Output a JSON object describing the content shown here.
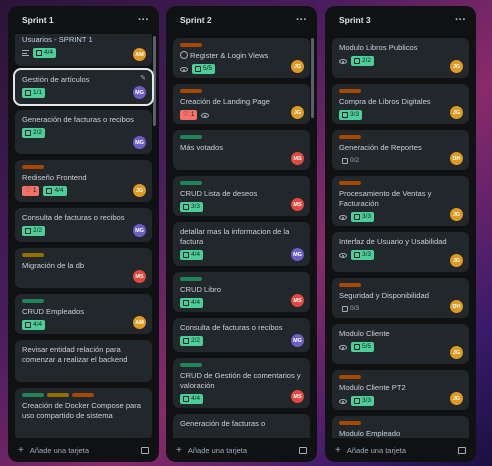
{
  "colors": {
    "orange": "#c25100",
    "orange_lbl": "#a54800",
    "green_lbl": "#1f845a",
    "yellow_lbl": "#946f00",
    "red_lbl": "#c9372c",
    "avatar_am": "#e09a22",
    "avatar_mg": "#6e5dc6",
    "avatar_jg": "#e0a000",
    "avatar_ms": "#e2483d",
    "avatar_dh": "#e0a000"
  },
  "footer": {
    "add_label": "Añade una tarjeta"
  },
  "lists": [
    {
      "title": "Sprint 1",
      "cards": [
        {
          "title": "Usuarios - SPRINT 1",
          "check": "4/4",
          "avatar": "AM"
        },
        {
          "title": "Gestión de artículos",
          "check": "1/1",
          "avatar": "MG"
        },
        {
          "title": "Generación de facturas o recibos",
          "check": "2/2",
          "avatar": "MG"
        },
        {
          "title": "Rediseño Frontend",
          "count": "1",
          "check": "4/4",
          "avatar": "JG"
        },
        {
          "title": "Consulta de facturas o recibos",
          "check": "2/2",
          "avatar": "MG"
        },
        {
          "title": "Migración de la db",
          "avatar": "MS"
        },
        {
          "title": "CRUD Empleados",
          "check": "4/4",
          "avatar": "AM"
        },
        {
          "title": "Revisar entidad relación para comenzar a realizar el backend"
        },
        {
          "title": "Creación de Docker Compose para uso compartido de sistema"
        }
      ]
    },
    {
      "title": "Sprint 2",
      "cards": [
        {
          "title": "Register & Login Views",
          "check": "5/5",
          "avatar": "JG"
        },
        {
          "title": "Creación de Landing Page",
          "count": "1",
          "avatar": "JG"
        },
        {
          "title": "Más votados",
          "avatar": "MS"
        },
        {
          "title": "CRUD Lista de deseos",
          "check": "3/3",
          "avatar": "MS"
        },
        {
          "title": "detallar mas la informacion de la factura",
          "check": "4/4",
          "avatar": "MG"
        },
        {
          "title": "CRUD Libro",
          "check": "4/4",
          "avatar": "MS"
        },
        {
          "title": "Consulta de facturas o recibos",
          "check": "2/2",
          "avatar": "MG"
        },
        {
          "title": "CRUD de Gestión de comentarios y valoración",
          "check": "4/4",
          "avatar": "MS"
        },
        {
          "title": "Generación de facturas o"
        }
      ]
    },
    {
      "title": "Sprint 3",
      "cards": [
        {
          "title": "Modulo Libros Publicos",
          "check": "2/2",
          "avatar": "JG"
        },
        {
          "title": "Compra de Libros Digitales",
          "check": "3/3",
          "avatar": "JG"
        },
        {
          "title": "Generación de Reportes",
          "check": "0/2",
          "avatar": "DH"
        },
        {
          "title": "Procesamiento de Ventas y Facturación",
          "check": "3/3",
          "avatar": "JG"
        },
        {
          "title": "Interfaz de Usuario y Usabilidad",
          "check": "3/3",
          "avatar": "JG"
        },
        {
          "title": "Seguridad y Disponibilidad",
          "check": "0/3",
          "avatar": "DH"
        },
        {
          "title": "Modulo Cliente",
          "check": "5/5",
          "avatar": "JG"
        },
        {
          "title": "Modulo Cliente PT2",
          "check": "3/3",
          "avatar": "JG"
        },
        {
          "title": "Modulo Empleado"
        }
      ]
    }
  ]
}
